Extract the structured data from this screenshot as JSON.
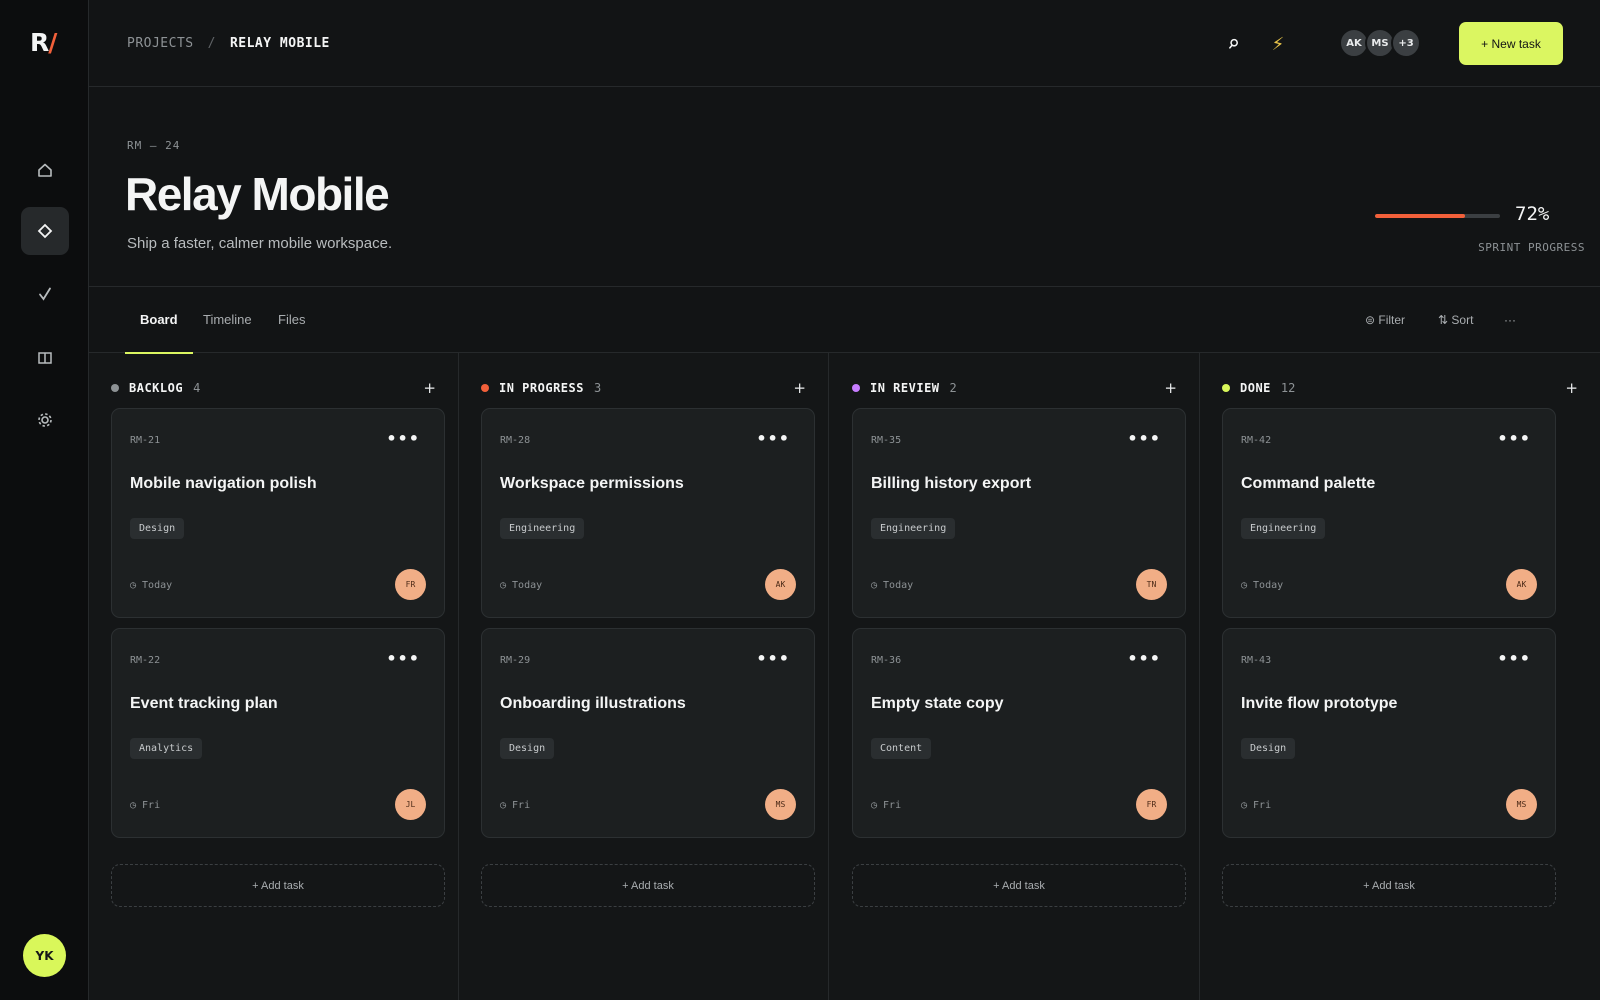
{
  "app": {
    "logo_text": "R",
    "logo_slash": "/",
    "user_initials": "YK"
  },
  "sidebar": {
    "items": [
      {
        "name": "home",
        "icon": "home-icon"
      },
      {
        "name": "projects",
        "icon": "diamond-icon",
        "active": true
      },
      {
        "name": "tasks",
        "icon": "check-icon"
      },
      {
        "name": "layout",
        "icon": "columns-icon"
      },
      {
        "name": "settings",
        "icon": "gear-icon"
      }
    ]
  },
  "header": {
    "breadcrumb": [
      "PROJECTS",
      "RELAY MOBILE"
    ],
    "separator": "/",
    "team": [
      "AK",
      "MS",
      "+3"
    ],
    "new_task_label": "+ New task"
  },
  "project": {
    "id": "RM — 24",
    "title": "Relay Mobile",
    "description": "Ship a faster, calmer mobile workspace.",
    "progress_percent": 72,
    "progress_text": "72%",
    "progress_label": "SPRINT PROGRESS"
  },
  "tabs": [
    "Board",
    "Timeline",
    "Files"
  ],
  "toolbar": {
    "filter_label": "⊜ Filter",
    "sort_label": "⇅ Sort",
    "more_label": "···"
  },
  "colors": {
    "accent": "#dbf661",
    "backlog": "#8d9295",
    "in_progress": "#f2603a",
    "in_review": "#c77dff",
    "done": "#d9f75a"
  },
  "columns": [
    {
      "title": "BACKLOG",
      "count": "4",
      "color": "#8d9295",
      "cards": [
        {
          "id": "RM-21",
          "title": "Mobile navigation polish",
          "tag": "Design",
          "due": "◷ Today",
          "avatar": "FR"
        },
        {
          "id": "RM-22",
          "title": "Event tracking plan",
          "tag": "Analytics",
          "due": "◷ Fri",
          "avatar": "JL"
        }
      ]
    },
    {
      "title": "IN PROGRESS",
      "count": "3",
      "color": "#f2603a",
      "cards": [
        {
          "id": "RM-28",
          "title": "Workspace permissions",
          "tag": "Engineering",
          "due": "◷ Today",
          "avatar": "AK"
        },
        {
          "id": "RM-29",
          "title": "Onboarding illustrations",
          "tag": "Design",
          "due": "◷ Fri",
          "avatar": "MS"
        }
      ]
    },
    {
      "title": "IN REVIEW",
      "count": "2",
      "color": "#c77dff",
      "cards": [
        {
          "id": "RM-35",
          "title": "Billing history export",
          "tag": "Engineering",
          "due": "◷ Today",
          "avatar": "TN"
        },
        {
          "id": "RM-36",
          "title": "Empty state copy",
          "tag": "Content",
          "due": "◷ Fri",
          "avatar": "FR"
        }
      ]
    },
    {
      "title": "DONE",
      "count": "12",
      "color": "#d9f75a",
      "cards": [
        {
          "id": "RM-42",
          "title": "Command palette",
          "tag": "Engineering",
          "due": "◷ Today",
          "avatar": "AK"
        },
        {
          "id": "RM-43",
          "title": "Invite flow prototype",
          "tag": "Design",
          "due": "◷ Fri",
          "avatar": "MS"
        }
      ]
    }
  ],
  "add_task_label": "+ Add task",
  "column_add_label": "+",
  "card_more_label": "•••"
}
